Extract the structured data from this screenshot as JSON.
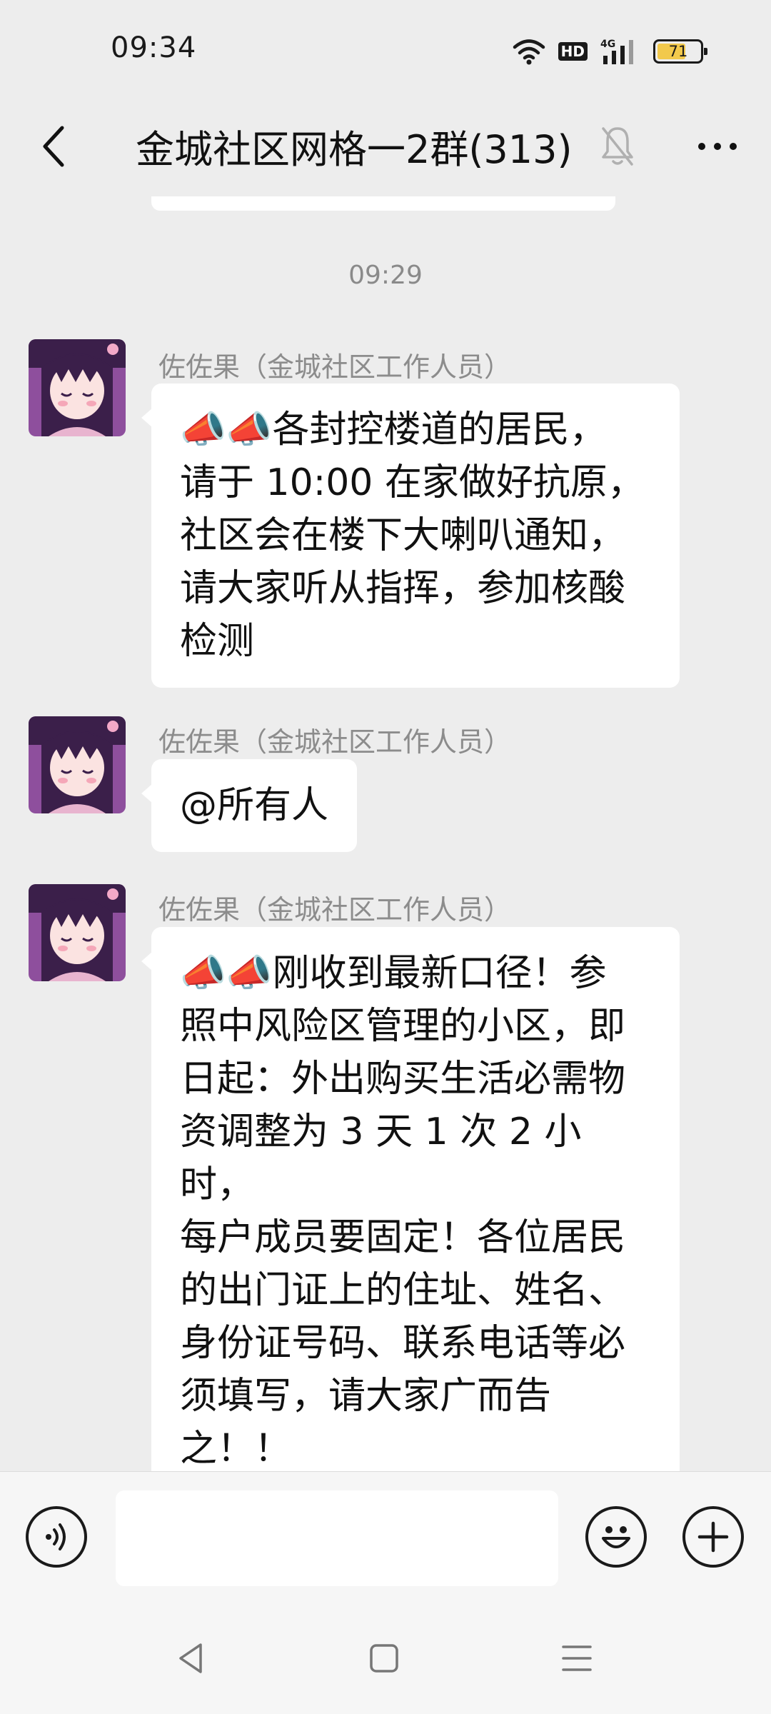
{
  "status_bar": {
    "time": "09:34",
    "battery_level": "71",
    "hd_label": "HD",
    "network_label": "4G",
    "icons": [
      "wifi-icon",
      "hd-icon",
      "signal-icon",
      "battery-icon"
    ]
  },
  "header": {
    "title": "金城社区网格一2群(313)",
    "icons": [
      "back-arrow-icon",
      "mute-bell-icon",
      "more-icon"
    ]
  },
  "chat": {
    "timestamp": "09:29",
    "messages": [
      {
        "sender": "佐佐果（金城社区工作人员）",
        "text": "📣📣各封控楼道的居民，\n请于 10:00 在家做好抗原，\n社区会在楼下大喇叭通知，\n请大家听从指挥，参加核酸\n检测"
      },
      {
        "sender": "佐佐果（金城社区工作人员）",
        "text": "@所有人"
      },
      {
        "sender": "佐佐果（金城社区工作人员）",
        "text": "📣📣刚收到最新口径！参\n照中风险区管理的小区，即\n日起：外出购买生活必需物\n资调整为 3 天 1 次 2 小时，\n每户成员要固定！各位居民\n的出门证上的住址、姓名、\n身份证号码、联系电话等必\n须填写，请大家广而告\n之！！"
      }
    ]
  },
  "input_bar": {
    "value": "",
    "icons": [
      "voice-icon",
      "emoji-icon",
      "plus-icon"
    ]
  },
  "nav_bar": {
    "icons": [
      "nav-back-icon",
      "nav-home-icon",
      "nav-menu-icon"
    ]
  },
  "colors": {
    "background": "#ededed",
    "bubble": "#ffffff",
    "sender_text": "#8c8c8c",
    "battery_fill": "#f2c94c"
  }
}
